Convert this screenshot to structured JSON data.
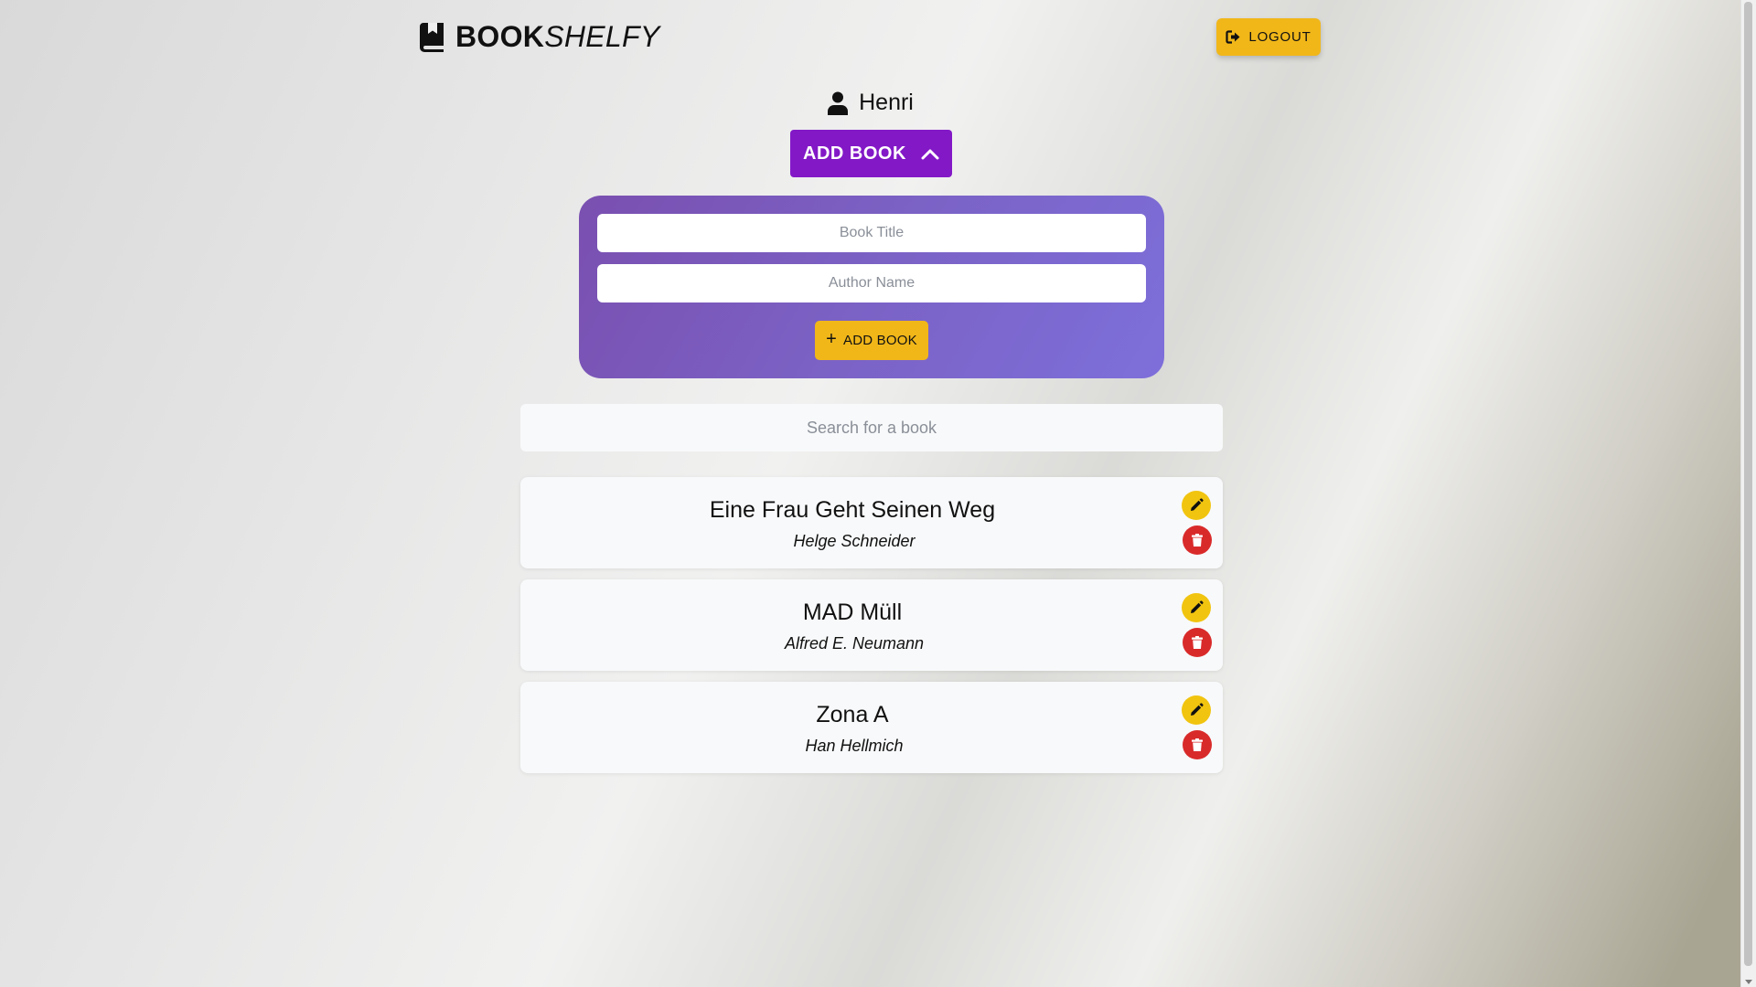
{
  "header": {
    "brand_bold": "BOOK",
    "brand_italic": "SHELFY",
    "logout_label": "LOGOUT"
  },
  "user": {
    "name": "Henri"
  },
  "add_toggle": {
    "label": "ADD BOOK"
  },
  "add_form": {
    "title_placeholder": "Book Title",
    "title_value": "",
    "author_placeholder": "Author Name",
    "author_value": "",
    "submit_label": "ADD BOOK"
  },
  "search": {
    "placeholder": "Search for a book",
    "value": ""
  },
  "books": [
    {
      "title": "Eine Frau Geht Seinen Weg",
      "author": "Helge Schneider"
    },
    {
      "title": "MAD Müll",
      "author": "Alfred E. Neumann"
    },
    {
      "title": "Zona A",
      "author": "Han Hellmich"
    }
  ],
  "icons": {
    "brand": "book-bookmark-icon",
    "logout": "sign-out-icon",
    "user": "user-icon",
    "toggle": "chevron-up-icon",
    "add": "plus-icon",
    "edit": "pencil-icon",
    "delete": "trash-icon"
  },
  "colors": {
    "accent_purple": "#8318c7",
    "panel_purple": "#7b62c5",
    "yellow": "#f1b719",
    "delete_red": "#d92a2a"
  }
}
